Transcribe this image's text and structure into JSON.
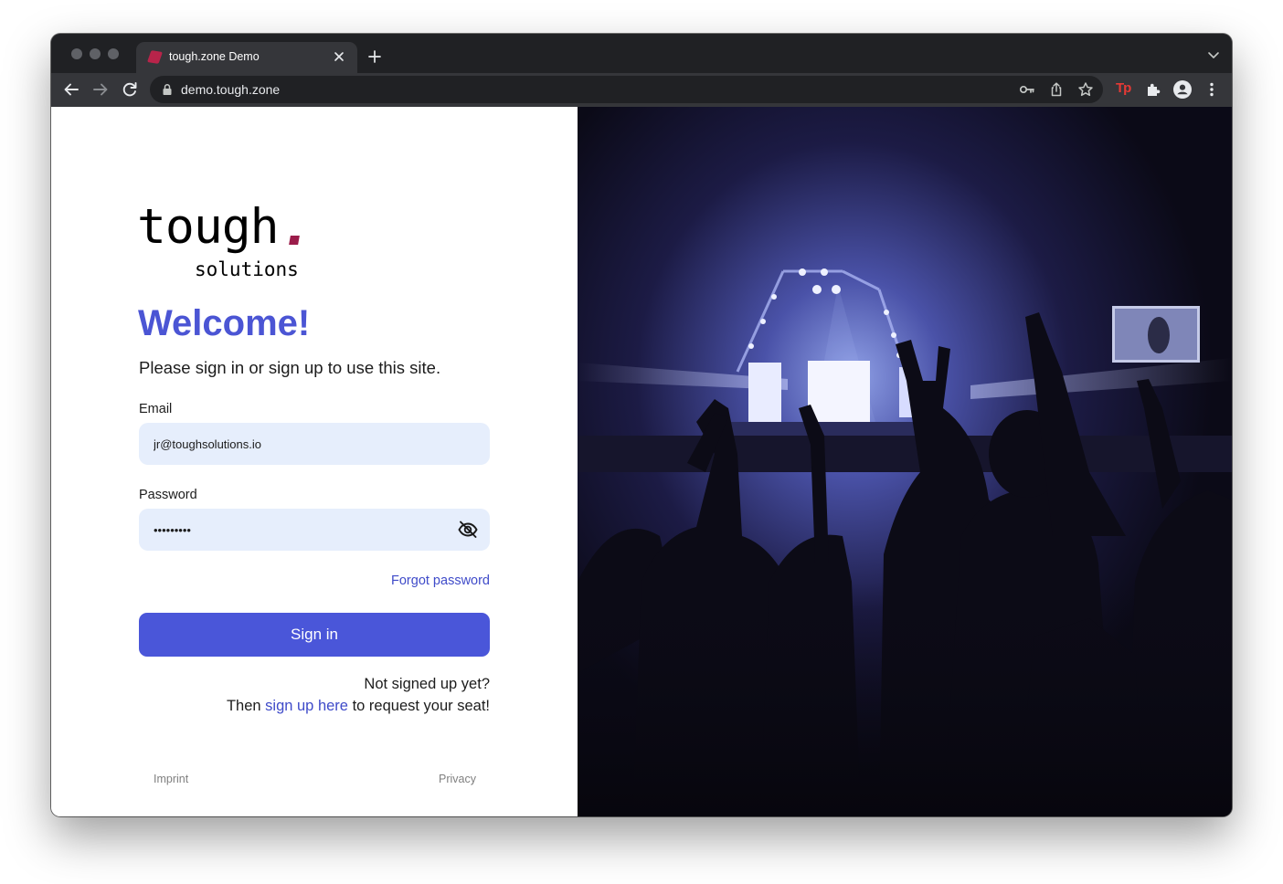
{
  "browser": {
    "tab": {
      "title": "tough.zone Demo",
      "close_icon": "close-icon",
      "favicon": "tough-favicon"
    },
    "new_tab_icon": "plus-icon",
    "tab_search_icon": "chevron-down-icon",
    "toolbar": {
      "back_icon": "arrow-left-icon",
      "forward_icon": "arrow-right-icon",
      "reload_icon": "reload-icon",
      "url": "demo.tough.zone",
      "lock_icon": "lock-icon",
      "omnibox_icons": [
        "key-icon",
        "share-icon",
        "star-icon"
      ],
      "extensions": [
        "tp-extension-icon",
        "puzzle-icon",
        "profile-icon",
        "more-vert-icon"
      ],
      "tp_extension_label": "Tp"
    }
  },
  "page": {
    "logo": {
      "word": "tough",
      "sub": "solutions",
      "dot_color": "#9b1c4a"
    },
    "heading": "Welcome!",
    "subtitle": "Please sign in or sign up to use this site.",
    "email": {
      "label": "Email",
      "value": "jr@toughsolutions.io"
    },
    "password": {
      "label": "Password",
      "value": "•••••••••",
      "toggle_icon": "eye-off-icon"
    },
    "forgot_password": "Forgot password",
    "sign_in": "Sign in",
    "signup": {
      "line1": "Not signed up yet?",
      "line2_before": "Then ",
      "link": "sign up here",
      "line2_after": " to request your seat!"
    },
    "footer": {
      "imprint": "Imprint",
      "privacy": "Privacy"
    },
    "hero_image": "concert-crowd-photo"
  },
  "colors": {
    "accent": "#4a56d9",
    "link": "#3f4bc9",
    "input_bg": "#e6eefc",
    "chrome_dark": "#202124",
    "chrome_toolbar": "#35363a"
  }
}
